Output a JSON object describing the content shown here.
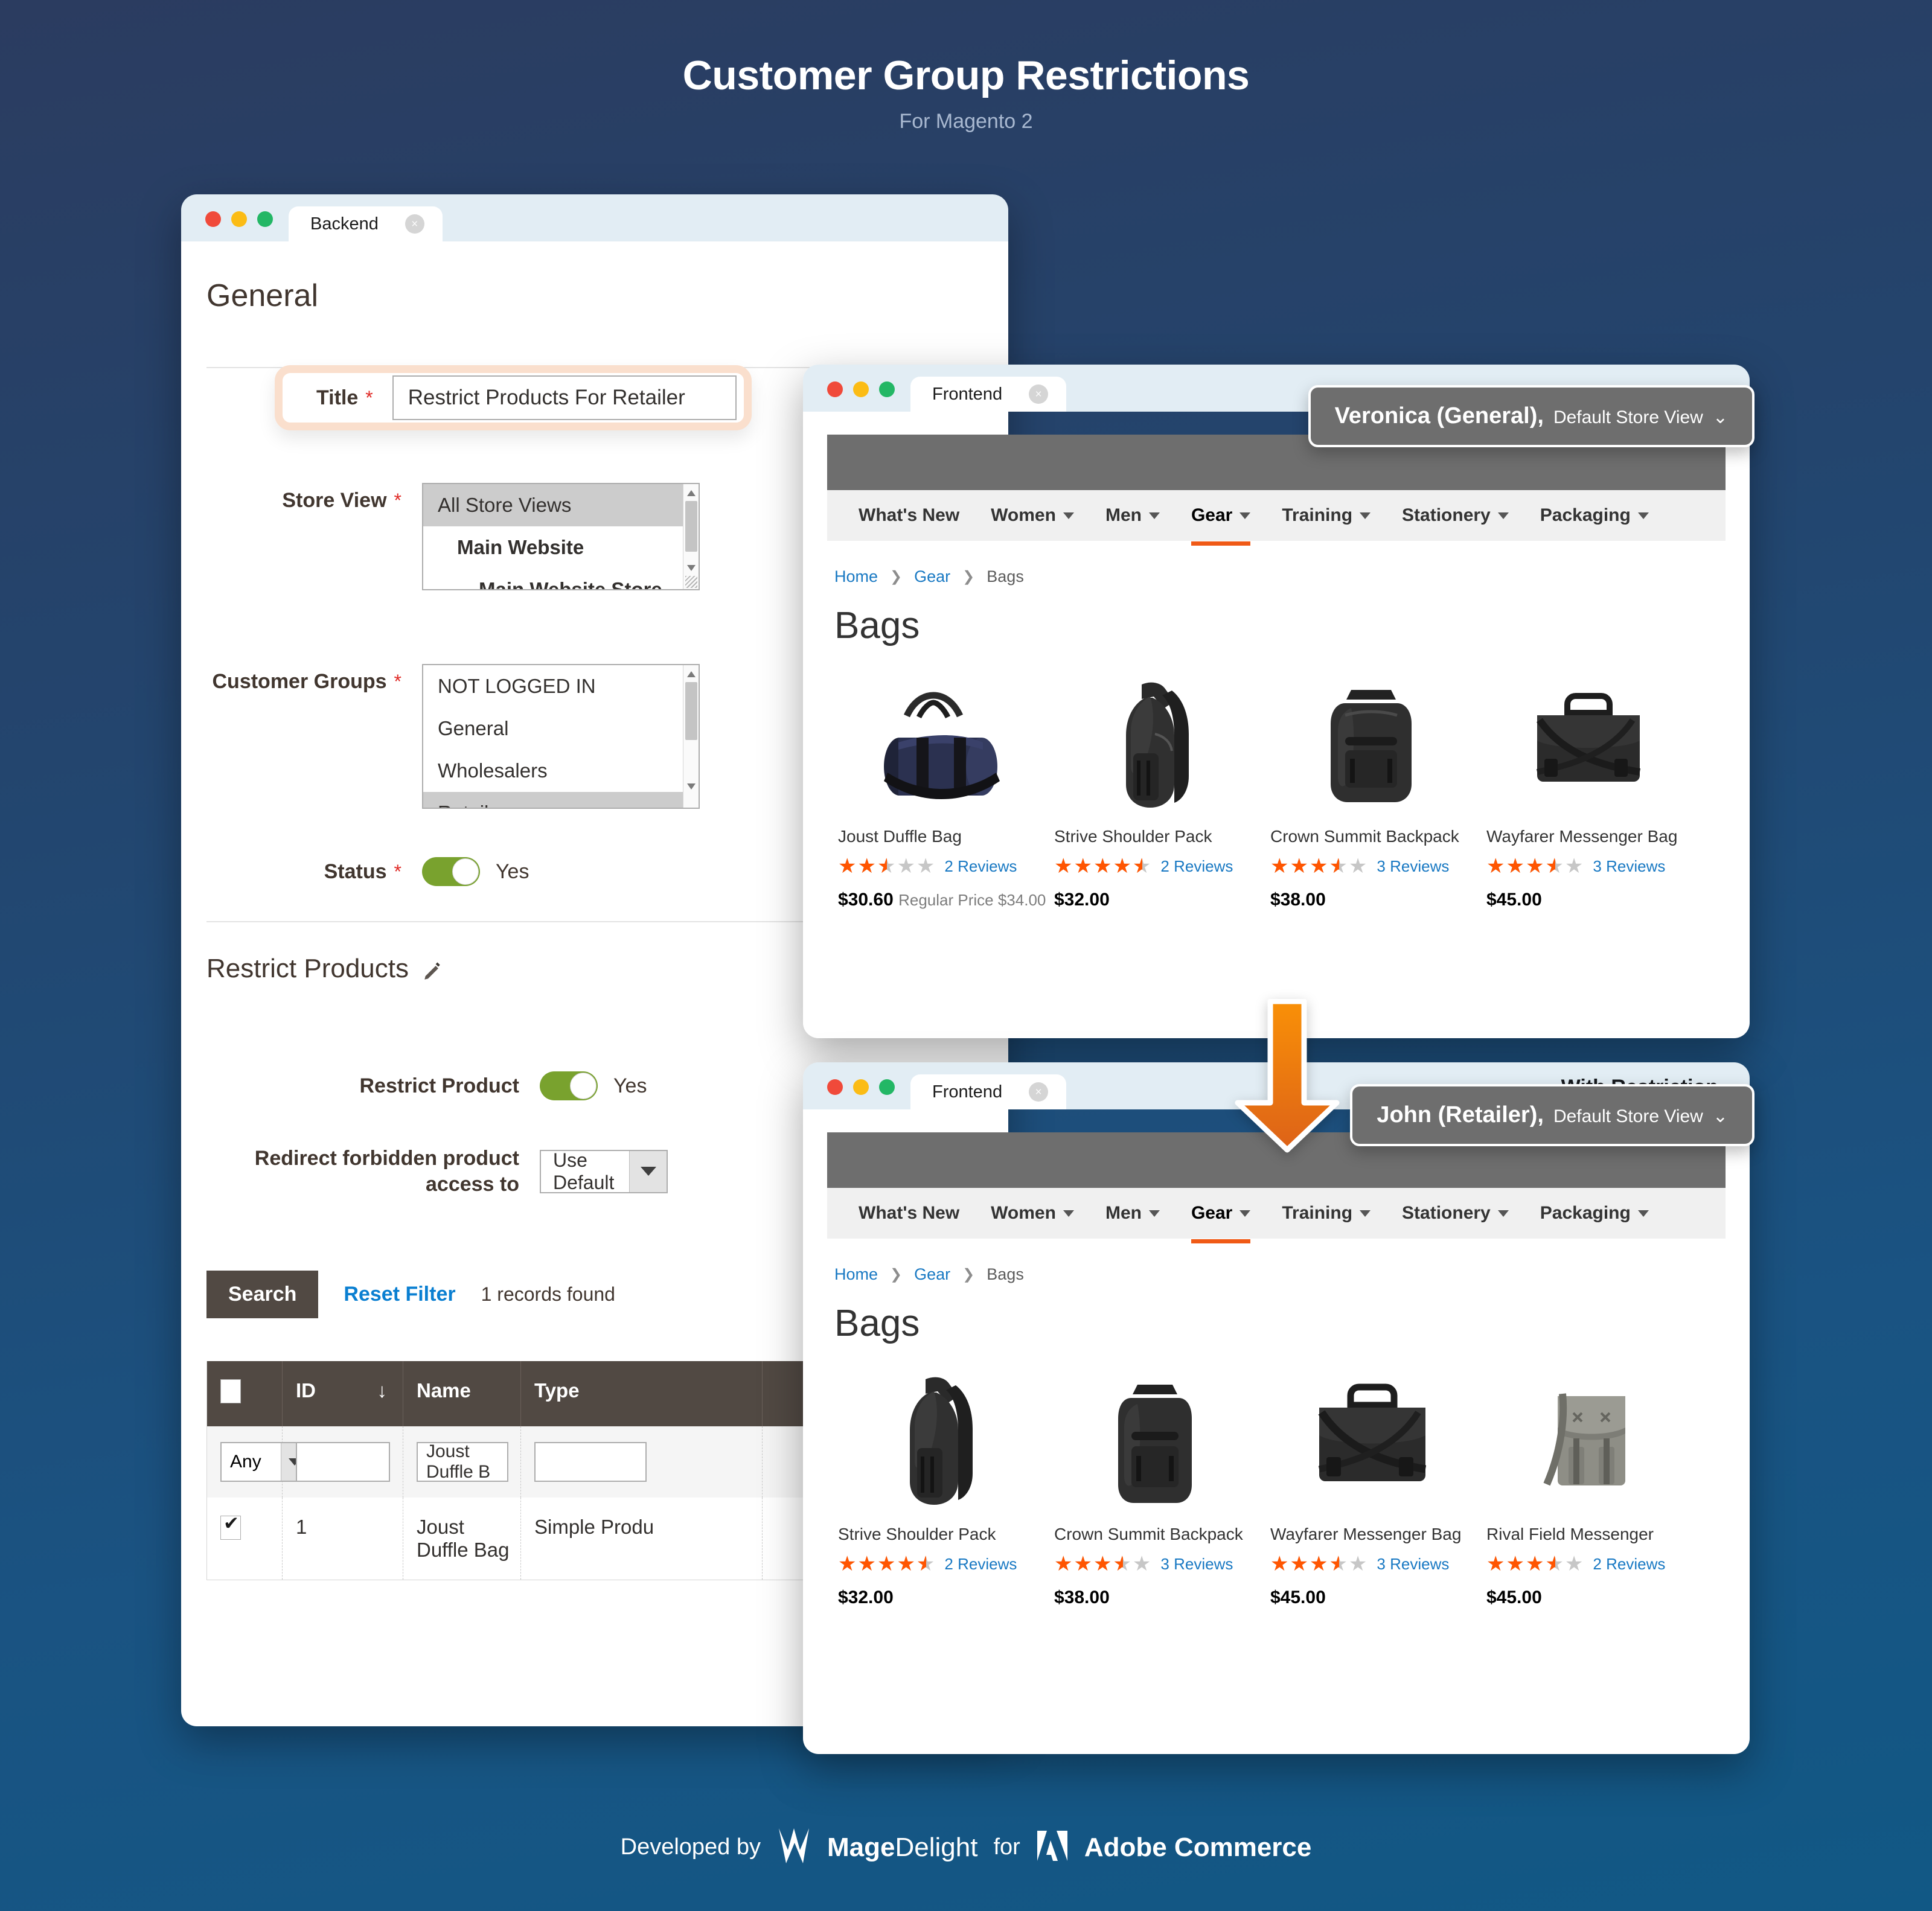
{
  "hero": {
    "title": "Customer Group Restrictions",
    "subtitle": "For Magento 2"
  },
  "backend": {
    "tab_label": "Backend",
    "close_icon": "close-icon",
    "section_general": "General",
    "title_label": "Title",
    "title_value": "Restrict Products For Retailer",
    "required_mark": "*",
    "store_view_label": "Store View",
    "store_view_options": [
      "All Store Views",
      "Main Website",
      "Main Website Store"
    ],
    "customer_groups_label": "Customer Groups",
    "customer_groups_options": [
      "NOT LOGGED IN",
      "General",
      "Wholesalers",
      "Retailer"
    ],
    "status_label": "Status",
    "status_value": "Yes",
    "section_restrict_products": "Restrict Products",
    "edit_icon": "pencil-icon",
    "restrict_product_label": "Restrict Product",
    "restrict_product_value": "Yes",
    "redirect_label": "Redirect forbidden product access to",
    "redirect_value": "Use Default",
    "search_button": "Search",
    "reset_filter": "Reset Filter",
    "records_found": "1 records found",
    "grid": {
      "headers": [
        "",
        "ID",
        "Name",
        "Type"
      ],
      "sort_arrow": "↓",
      "filters": {
        "any": "Any",
        "id": "",
        "name": "Joust Duffle B",
        "type": ""
      },
      "rows": [
        {
          "checked": true,
          "id": "1",
          "name": "Joust Duffle Bag",
          "type": "Simple Produ"
        }
      ]
    }
  },
  "frontend_before": {
    "tab_label": "Frontend",
    "close_icon": "close-icon",
    "user_badge": {
      "name": "Veronica (General),",
      "store_view": "Default Store View"
    },
    "nav": [
      "What's New",
      "Women",
      "Men",
      "Gear",
      "Training",
      "Stationery",
      "Packaging"
    ],
    "nav_active": "Gear",
    "breadcrumbs": [
      "Home",
      "Gear",
      "Bags"
    ],
    "category_title": "Bags",
    "products": [
      {
        "name": "Joust Duffle Bag",
        "rating": 50,
        "reviews": "2 Reviews",
        "price": "$30.60",
        "regular_price_label": "Regular Price $34.00"
      },
      {
        "name": "Strive Shoulder Pack",
        "rating": 90,
        "reviews": "2 Reviews",
        "price": "$32.00",
        "regular_price_label": ""
      },
      {
        "name": "Crown Summit Backpack",
        "rating": 70,
        "reviews": "3 Reviews",
        "price": "$38.00",
        "regular_price_label": ""
      },
      {
        "name": "Wayfarer Messenger Bag",
        "rating": 70,
        "reviews": "3 Reviews",
        "price": "$45.00",
        "regular_price_label": ""
      }
    ]
  },
  "frontend_after": {
    "tab_label": "Frontend",
    "close_icon": "close-icon",
    "chrome_label": "With Restriction",
    "user_badge": {
      "name": "John (Retailer),",
      "store_view": "Default Store View"
    },
    "nav": [
      "What's New",
      "Women",
      "Men",
      "Gear",
      "Training",
      "Stationery",
      "Packaging"
    ],
    "nav_active": "Gear",
    "breadcrumbs": [
      "Home",
      "Gear",
      "Bags"
    ],
    "category_title": "Bags",
    "products": [
      {
        "name": "Strive Shoulder Pack",
        "rating": 90,
        "reviews": "2 Reviews",
        "price": "$32.00",
        "regular_price_label": ""
      },
      {
        "name": "Crown Summit Backpack",
        "rating": 70,
        "reviews": "3 Reviews",
        "price": "$38.00",
        "regular_price_label": ""
      },
      {
        "name": "Wayfarer Messenger Bag",
        "rating": 70,
        "reviews": "3 Reviews",
        "price": "$45.00",
        "regular_price_label": ""
      },
      {
        "name": "Rival Field Messenger",
        "rating": 70,
        "reviews": "2 Reviews",
        "price": "$45.00",
        "regular_price_label": ""
      }
    ]
  },
  "arrow_icon": "down-arrow-icon",
  "footer": {
    "developed_by": "Developed by",
    "magedelight_bold": "Mage",
    "magedelight_light": "Delight",
    "for": "for",
    "adobe": "Adobe Commerce"
  },
  "colors": {
    "accent_orange": "#f05a16",
    "link_blue": "#1979c3",
    "toggle_green": "#79a22e",
    "grid_header": "#514943",
    "star_orange": "#ff5501",
    "required_red": "#e02b27"
  }
}
